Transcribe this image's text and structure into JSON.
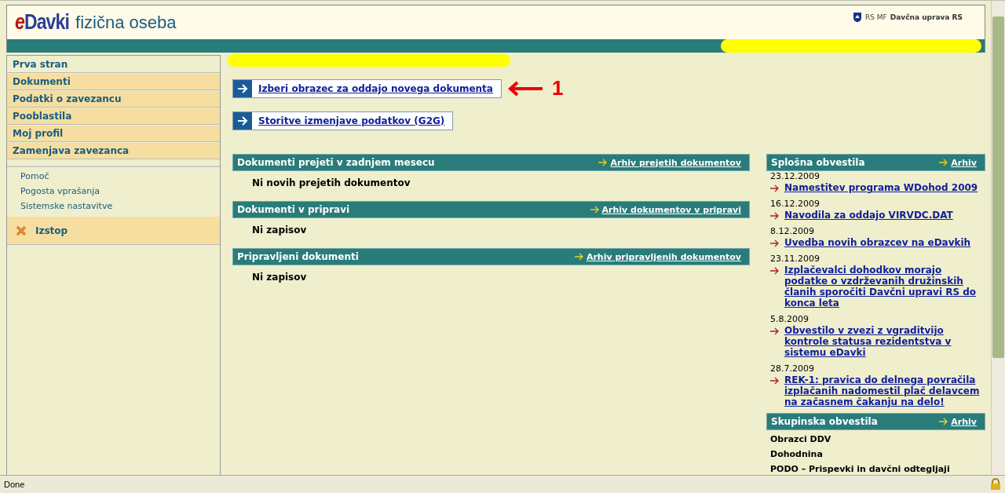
{
  "header": {
    "logo": "eDavki",
    "title": "fizična oseba",
    "agency_prefix": "RS MF",
    "agency": "Davčna uprava RS"
  },
  "sidebar": {
    "menu": [
      {
        "label": "Prva stran",
        "selected": true
      },
      {
        "label": "Dokumenti",
        "selected": false
      },
      {
        "label": "Podatki o zavezancu",
        "selected": false
      },
      {
        "label": "Pooblastila",
        "selected": false
      },
      {
        "label": "Moj profil",
        "selected": false
      },
      {
        "label": "Zamenjava zavezanca",
        "selected": false
      }
    ],
    "links": [
      "Pomoč",
      "Pogosta vprašanja",
      "Sistemske nastavitve"
    ],
    "logout": "Izstop"
  },
  "actions": [
    {
      "label": "Izberi obrazec za oddajo novega dokumenta",
      "annotation": "1"
    },
    {
      "label": "Storitve izmenjave podatkov (G2G)"
    }
  ],
  "panels": [
    {
      "title": "Dokumenti prejeti v zadnjem mesecu",
      "archive": "Arhiv prejetih dokumentov",
      "message": "Ni novih prejetih dokumentov"
    },
    {
      "title": "Dokumenti v pripravi",
      "archive": "Arhiv dokumentov v pripravi",
      "message": "Ni zapisov"
    },
    {
      "title": "Pripravljeni dokumenti",
      "archive": "Arhiv pripravljenih dokumentov",
      "message": "Ni zapisov"
    }
  ],
  "news": {
    "title": "Splošna obvestila",
    "archive": "Arhiv",
    "items": [
      {
        "date": "23.12.2009",
        "text": "Namestitev programa WDohod 2009"
      },
      {
        "date": "16.12.2009",
        "text": "Navodila za oddajo VIRVDC.DAT"
      },
      {
        "date": "8.12.2009",
        "text": "Uvedba novih obrazcev na eDavkih"
      },
      {
        "date": "23.11.2009",
        "text": "Izplačevalci dohodkov morajo podatke o vzdrževanih družinskih članih sporočiti Davčni upravi RS do konca leta"
      },
      {
        "date": "5.8.2009",
        "text": "Obvestilo v zvezi z vgraditvijo kontrole statusa rezidentstva v sistemu eDavki"
      },
      {
        "date": "28.7.2009",
        "text": "REK-1: pravica do delnega povračila izplačanih nadomestil plač delavcem na začasnem čakanju na delo!"
      }
    ]
  },
  "group_news": {
    "title": "Skupinska obvestila",
    "archive": "Arhiv",
    "items": [
      "Obrazci DDV",
      "Dohodnina",
      "PODO – Prispevki in davčni odtegljaji"
    ]
  },
  "status_bar": {
    "text": "Done"
  }
}
